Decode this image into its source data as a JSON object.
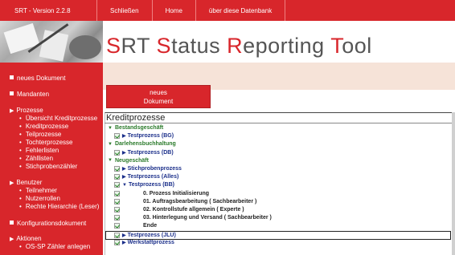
{
  "topbar": {
    "version": "SRT - Version 2.2.8",
    "links": [
      "Schließen",
      "Home",
      "über diese Datenbank"
    ]
  },
  "header": {
    "title_parts": [
      {
        "cap": "S",
        "rest": "RT "
      },
      {
        "cap": "S",
        "rest": "tatus "
      },
      {
        "cap": "R",
        "rest": "eporting "
      },
      {
        "cap": "T",
        "rest": "ool"
      }
    ]
  },
  "nav": {
    "new_document": "neues Dokument",
    "clients": "Mandanten",
    "processes": {
      "label": "Prozesse",
      "items": [
        "Übersicht Kreditprozesse",
        "Kreditprozesse",
        "Teilprozesse",
        "Tochterprozesse",
        "Fehlerlisten",
        "Zähllisten",
        "Stichprobenzähler"
      ]
    },
    "users": {
      "label": "Benutzer",
      "items": [
        "Teilnehmer",
        "Nutzerrollen",
        "Rechte Hierarchie (Leser)"
      ]
    },
    "config": "Konfigurationsdokument",
    "actions": {
      "label": "Aktionen",
      "items": [
        "OS-SP Zähler anlegen"
      ]
    }
  },
  "button": {
    "line1": "neues",
    "line2": "Dokument"
  },
  "panel": {
    "title": "Kreditprozesse",
    "rows": [
      {
        "kind": "group",
        "text": "Bestandsgeschäft"
      },
      {
        "kind": "link",
        "text": "Testprozess (BG)"
      },
      {
        "kind": "group",
        "text": "Darlehensbuchhaltung"
      },
      {
        "kind": "link",
        "text": "Testprozess (DB)"
      },
      {
        "kind": "group",
        "text": "Neugeschäft"
      },
      {
        "kind": "link",
        "text": "Stichprobenprozess"
      },
      {
        "kind": "link",
        "text": "Testprozess (Alles)"
      },
      {
        "kind": "link-open",
        "text": "Testprozess (BB)"
      },
      {
        "kind": "step",
        "text": "0. Prozess Initialisierung"
      },
      {
        "kind": "step",
        "text": "01. Auftragsbearbeitung ( Sachbearbeiter )"
      },
      {
        "kind": "step",
        "text": "02. Kontrollstufe allgemein ( Experte )"
      },
      {
        "kind": "step",
        "text": "03. Hinterlegung und Versand ( Sachbearbeiter )"
      },
      {
        "kind": "step",
        "text": "Ende"
      },
      {
        "kind": "link-selected",
        "text": "Testprozess (JLU)"
      },
      {
        "kind": "link",
        "text": "Werkstattprozess"
      }
    ]
  }
}
